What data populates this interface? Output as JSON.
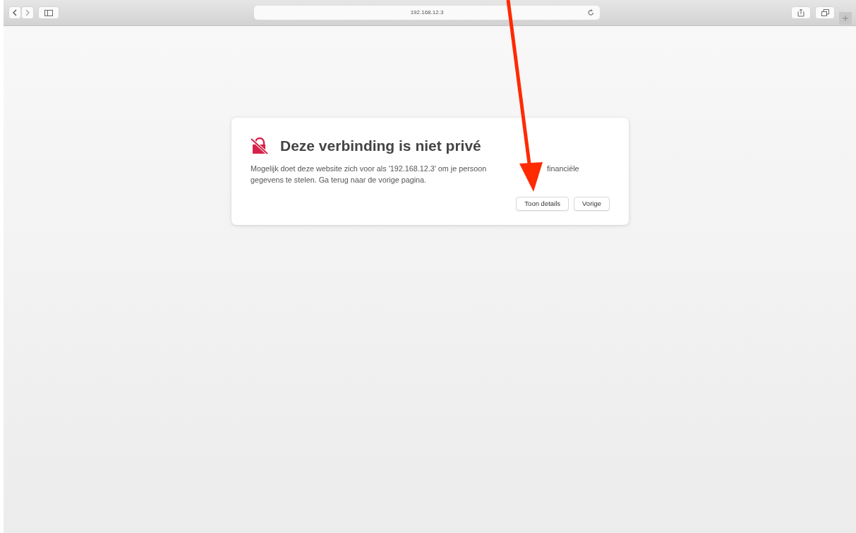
{
  "toolbar": {
    "address": "192.168.12.3"
  },
  "warning": {
    "title": "Deze verbinding is niet privé",
    "message_lines": [
      [
        "Mogelijk doet deze website zich voor als '192.168.12.3' om je persoon",
        "financiële"
      ],
      [
        "gegevens te stelen. Ga terug naar de vorige pagina."
      ]
    ],
    "buttons": [
      "Toon details",
      "Vorige"
    ]
  }
}
